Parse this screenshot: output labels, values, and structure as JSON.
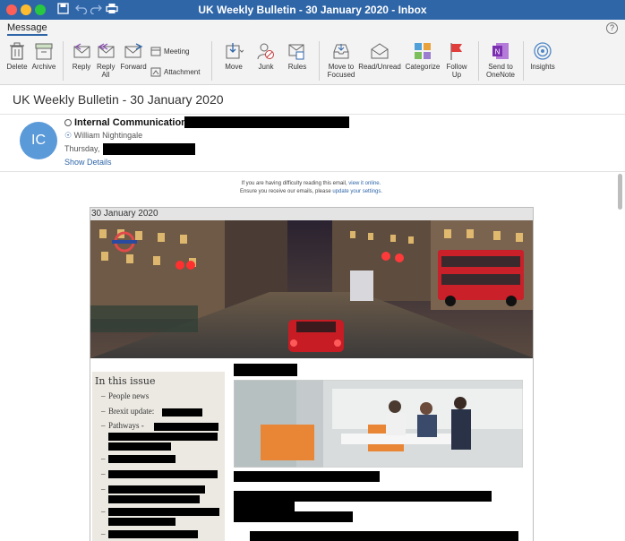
{
  "window": {
    "title": "UK Weekly Bulletin - 30 January 2020 - Inbox"
  },
  "ribbon": {
    "tab": "Message",
    "help_label": "?",
    "buttons": {
      "delete": "Delete",
      "archive": "Archive",
      "reply": "Reply",
      "reply_all": "Reply All",
      "forward": "Forward",
      "meeting": "Meeting",
      "attachment": "Attachment",
      "move": "Move",
      "junk": "Junk",
      "rules": "Rules",
      "move_to_focused": "Move to Focused",
      "read_unread": "Read/Unread",
      "categorize": "Categorize",
      "follow_up": "Follow Up",
      "send_to_onenote": "Send to OneNote",
      "insights": "Insights"
    }
  },
  "message": {
    "subject": "UK Weekly Bulletin - 30 January 2020",
    "sender_initials": "IC",
    "sender_name": "Internal Communications",
    "on_behalf": "William Nightingale",
    "date_prefix": "Thursday,",
    "show_details": "Show Details"
  },
  "email_body": {
    "notice_line1": "If you are having difficulty reading this email,",
    "notice_link1": "view it online.",
    "notice_line2": "Ensure you receive our emails, please",
    "notice_link2": "update your settings.",
    "banner_date": "30 January 2020",
    "in_this_issue": {
      "title": "In this issue",
      "items": [
        "People news",
        "Brexit update:",
        "Pathways -"
      ]
    }
  },
  "colors": {
    "titlebar": "#2f66a8",
    "accent": "#2f66a8",
    "avatar": "#5b9ad8",
    "sidebar_bg": "#ece9e2"
  }
}
